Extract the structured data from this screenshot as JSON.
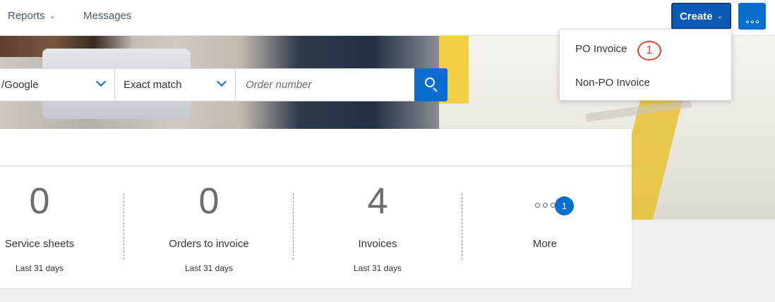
{
  "topnav": {
    "items": [
      {
        "label": "Reports"
      },
      {
        "label": "Messages"
      }
    ],
    "create_button": "Create"
  },
  "search": {
    "source_value": "/Google",
    "match_value": "Exact match",
    "order_placeholder": "Order number"
  },
  "stats": [
    {
      "value": "0",
      "label": "Service sheets",
      "period": "Last 31 days"
    },
    {
      "value": "0",
      "label": "Orders to invoice",
      "period": "Last 31 days"
    },
    {
      "value": "4",
      "label": "Invoices",
      "period": "Last 31 days"
    },
    {
      "label": "More",
      "badge": "1"
    }
  ],
  "create_menu": {
    "items": [
      {
        "label": "PO Invoice"
      },
      {
        "label": "Non-PO Invoice"
      }
    ],
    "callout": "1"
  },
  "colors": {
    "primary": "#0a6ed1",
    "create_button": "#0a5bb6",
    "callout": "#e0452b"
  },
  "icons": [
    "chevron-down-icon",
    "search-icon",
    "more-icon",
    "ellipsis-icon"
  ]
}
